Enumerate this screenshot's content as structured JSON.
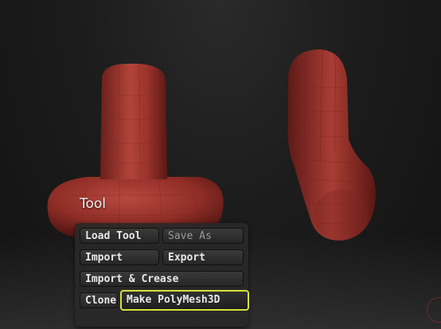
{
  "tool_panel": {
    "title": "Tool",
    "buttons": {
      "load_tool": "Load Tool",
      "save_as": "Save As",
      "import": "Import",
      "export": "Export",
      "import_crease": "Import & Crease",
      "clone": "Clone",
      "make_polymesh3d": "Make PolyMesh3D"
    },
    "highlight_color": "#d6e03a"
  },
  "colors": {
    "model_clay": "#a8352e",
    "background": "#1c1c1c"
  }
}
